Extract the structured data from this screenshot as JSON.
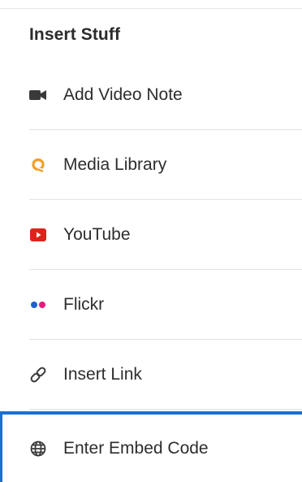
{
  "panel": {
    "heading": "Insert Stuff",
    "accent_color": "#1a6fd4"
  },
  "items": [
    {
      "label": "Add Video Note",
      "icon": "video-camera-icon",
      "icon_color": "#3a3a3a"
    },
    {
      "label": "Media Library",
      "icon": "media-library-icon",
      "icon_color": "#f0a028"
    },
    {
      "label": "YouTube",
      "icon": "youtube-icon",
      "icon_color": "#e0221b"
    },
    {
      "label": "Flickr",
      "icon": "flickr-icon",
      "icon_colors": [
        "#1f5fd0",
        "#e8197d"
      ]
    },
    {
      "label": "Insert Link",
      "icon": "link-icon",
      "icon_color": "#3a3a3a"
    },
    {
      "label": "Enter Embed Code",
      "icon": "globe-icon",
      "icon_color": "#3a3a3a",
      "selected": true
    }
  ]
}
